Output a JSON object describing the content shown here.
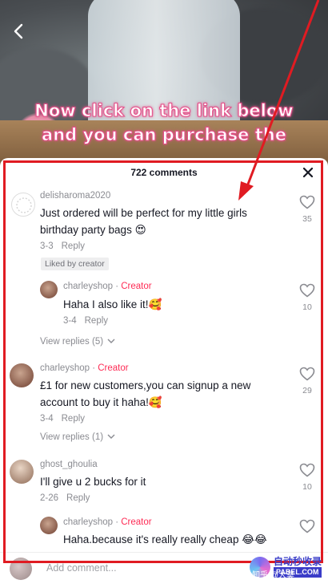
{
  "video": {
    "overlay_line1": "Now click on the link below",
    "overlay_line2": "and you can purchase the"
  },
  "sheet": {
    "title": "722 comments"
  },
  "comments": [
    {
      "username": "delisharoma2020",
      "text": "Just ordered will be perfect for my little girls birthday party bags 😍",
      "date": "3-3",
      "reply": "Reply",
      "badge": "Liked by creator",
      "likes": "35"
    },
    {
      "username": "charleyshop",
      "creator_tag": "Creator",
      "text": "Haha I also like it!🥰",
      "date": "3-4",
      "reply": "Reply",
      "likes": "10",
      "view_replies": "View replies (5)"
    },
    {
      "username": "charleyshop",
      "creator_tag": "Creator",
      "text": "£1 for new customers,you can signup a new account to buy it haha!🥰",
      "date": "3-4",
      "reply": "Reply",
      "likes": "29",
      "view_replies": "View replies (1)"
    },
    {
      "username": "ghost_ghoulia",
      "text": "I'll give u 2 bucks for it",
      "date": "2-26",
      "reply": "Reply",
      "likes": "10"
    },
    {
      "username": "charleyshop",
      "creator_tag": "Creator",
      "text": "Haha.because it's really really cheap 😂😂",
      "likes": ""
    }
  ],
  "bottom": {
    "add_comment_placeholder": "Add comment..."
  },
  "watermark": {
    "title": "自动秒收录",
    "sub": "PABEL.COM",
    "zhihu": "知乎 @大莫"
  },
  "colors": {
    "annotation_red": "#e01b22",
    "creator_red": "#fe2c55",
    "overlay_pink": "#e5508a"
  }
}
